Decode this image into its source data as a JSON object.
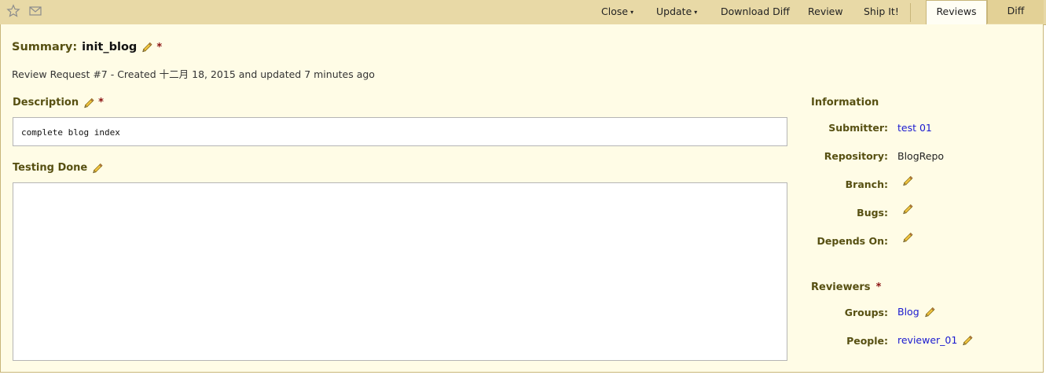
{
  "toolbar": {
    "close_label": "Close",
    "update_label": "Update",
    "download_diff_label": "Download Diff",
    "review_label": "Review",
    "ship_it_label": "Ship It!",
    "caret": "▾"
  },
  "tabs": [
    {
      "label": "Reviews",
      "active": true
    },
    {
      "label": "Diff",
      "active": false
    }
  ],
  "summary": {
    "label": "Summary:",
    "value": "init_blog",
    "required_mark": "*"
  },
  "subline": "Review Request #7 - Created 十二月 18, 2015 and updated 7 minutes ago",
  "description": {
    "label": "Description",
    "required_mark": "*",
    "text": "complete blog index"
  },
  "testing_done": {
    "label": "Testing Done",
    "text": ""
  },
  "information": {
    "title": "Information",
    "submitter_label": "Submitter:",
    "submitter_value": "test 01",
    "repository_label": "Repository:",
    "repository_value": "BlogRepo",
    "branch_label": "Branch:",
    "bugs_label": "Bugs:",
    "depends_on_label": "Depends On:"
  },
  "reviewers": {
    "title": "Reviewers",
    "required_mark": "*",
    "groups_label": "Groups:",
    "groups_value": "Blog",
    "people_label": "People:",
    "people_value": "reviewer_01"
  },
  "colors": {
    "toolbar_bg": "#e8d9a6",
    "panel_bg": "#fffce6",
    "label_color": "#575012",
    "link_color": "#1a1ad0",
    "required_color": "#8b1111"
  },
  "icons": [
    "star-icon",
    "mail-icon",
    "pencil-icon"
  ]
}
